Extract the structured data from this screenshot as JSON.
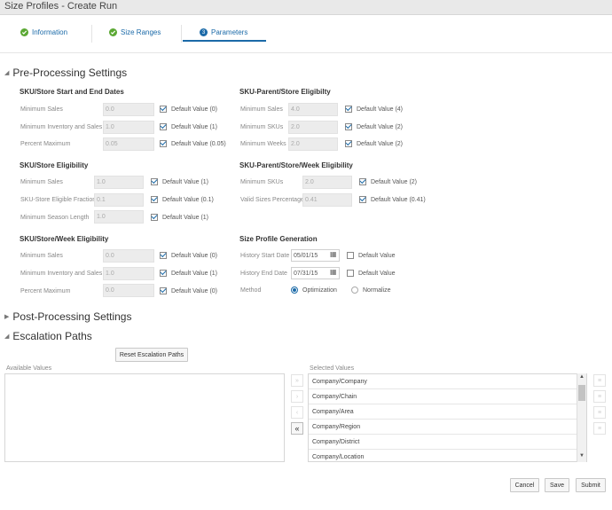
{
  "window": {
    "title": "Size Profiles - Create Run"
  },
  "tabs": [
    {
      "label": "Information",
      "icon": "check-circle-icon"
    },
    {
      "label": "Size Ranges",
      "icon": "check-circle-icon"
    },
    {
      "label": "Parameters",
      "number": "3"
    }
  ],
  "sections": {
    "pre": "Pre-Processing Settings",
    "post": "Post-Processing Settings",
    "escalation": "Escalation Paths"
  },
  "groups": {
    "start_end": {
      "title": "SKU/Store Start and End Dates",
      "rows": [
        {
          "label": "Minimum Sales",
          "value": "0.0",
          "default": "Default Value (0)"
        },
        {
          "label": "Minimum Inventory and Sales",
          "value": "1.0",
          "default": "Default Value (1)"
        },
        {
          "label": "Percent Maximum",
          "value": "0.05",
          "default": "Default Value (0.05)"
        }
      ]
    },
    "sku_store": {
      "title": "SKU/Store Eligibility",
      "rows": [
        {
          "label": "Minimum Sales",
          "value": "1.0",
          "default": "Default Value (1)"
        },
        {
          "label": "SKU-Store Eligible Fraction",
          "value": "0.1",
          "default": "Default Value (0.1)"
        },
        {
          "label": "Minimum Season Length",
          "value": "1.0",
          "default": "Default Value (1)"
        }
      ]
    },
    "sku_store_week": {
      "title": "SKU/Store/Week Eligibility",
      "rows": [
        {
          "label": "Minimum Sales",
          "value": "0.0",
          "default": "Default Value (0)"
        },
        {
          "label": "Minimum Inventory and Sales",
          "value": "1.0",
          "default": "Default Value (1)"
        },
        {
          "label": "Percent Maximum",
          "value": "0.0",
          "default": "Default Value (0)"
        }
      ]
    },
    "parent_store": {
      "title": "SKU-Parent/Store Eligibilty",
      "rows": [
        {
          "label": "Minimum Sales",
          "value": "4.0",
          "default": "Default Value (4)"
        },
        {
          "label": "Minimum SKUs",
          "value": "2.0",
          "default": "Default Value (2)"
        },
        {
          "label": "Minimum Weeks",
          "value": "2.0",
          "default": "Default Value (2)"
        }
      ]
    },
    "parent_store_week": {
      "title": "SKU-Parent/Store/Week Eligibility",
      "rows": [
        {
          "label": "Minimum SKUs",
          "value": "2.0",
          "default": "Default Value (2)"
        },
        {
          "label": "Valid Sizes Percentage",
          "value": "0.41",
          "default": "Default Value (0.41)"
        }
      ]
    },
    "generation": {
      "title": "Size Profile Generation",
      "start_label": "History Start Date",
      "start_value": "05/01/15",
      "end_label": "History End Date",
      "end_value": "07/31/15",
      "default_label": "Default Value",
      "method_label": "Method",
      "method_opt1": "Optimization",
      "method_opt2": "Normalize"
    }
  },
  "escalation": {
    "reset_label": "Reset Escalation Paths",
    "available_label": "Available Values",
    "selected_label": "Selected Values",
    "selected": [
      "Company/Company",
      "Company/Chain",
      "Company/Area",
      "Company/Region",
      "Company/District",
      "Company/Location"
    ]
  },
  "footer": {
    "cancel": "Cancel",
    "save": "Save",
    "submit": "Submit"
  }
}
